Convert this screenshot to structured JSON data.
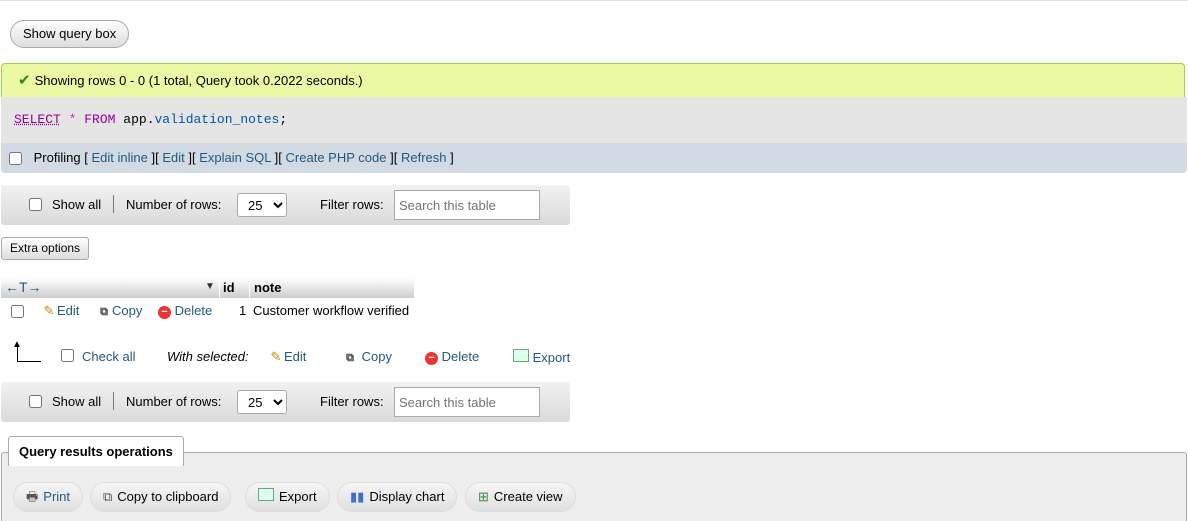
{
  "toolbar": {
    "show_query_box": "Show query box"
  },
  "message": {
    "text": "Showing rows 0 - 0 (1 total, Query took 0.2022 seconds.)"
  },
  "sql": {
    "select": "SELECT",
    "star": "*",
    "from": "FROM",
    "db": "app",
    "dot": ".",
    "table": "validation_notes",
    "semi": ";"
  },
  "sql_tools": {
    "profiling": "Profiling",
    "open": "[",
    "close": "]",
    "links": [
      "Edit inline",
      "Edit",
      "Explain SQL",
      "Create PHP code",
      "Refresh"
    ]
  },
  "nav": {
    "show_all": "Show all",
    "separator": "|",
    "rows_label": "Number of rows:",
    "rows_value": "25",
    "filter_label": "Filter rows:",
    "filter_placeholder": "Search this table"
  },
  "extra_options": "Extra options",
  "table": {
    "arrows": "←T→",
    "columns": [
      "id",
      "note"
    ],
    "rows": [
      {
        "edit": "Edit",
        "copy": "Copy",
        "delete": "Delete",
        "id": "1",
        "note": "Customer workflow verified"
      }
    ]
  },
  "with_selected": {
    "check_all": "Check all",
    "label": "With selected:",
    "edit": "Edit",
    "copy": "Copy",
    "delete": "Delete",
    "export": "Export"
  },
  "operations": {
    "title": "Query results operations",
    "buttons": [
      "Print",
      "Copy to clipboard",
      "Export",
      "Display chart",
      "Create view"
    ]
  },
  "colors": {
    "link": "#235a81",
    "success_bg": "#ebf8a4",
    "sql_bg": "#e5e5e5",
    "tools_bg": "#d2dbe3"
  }
}
